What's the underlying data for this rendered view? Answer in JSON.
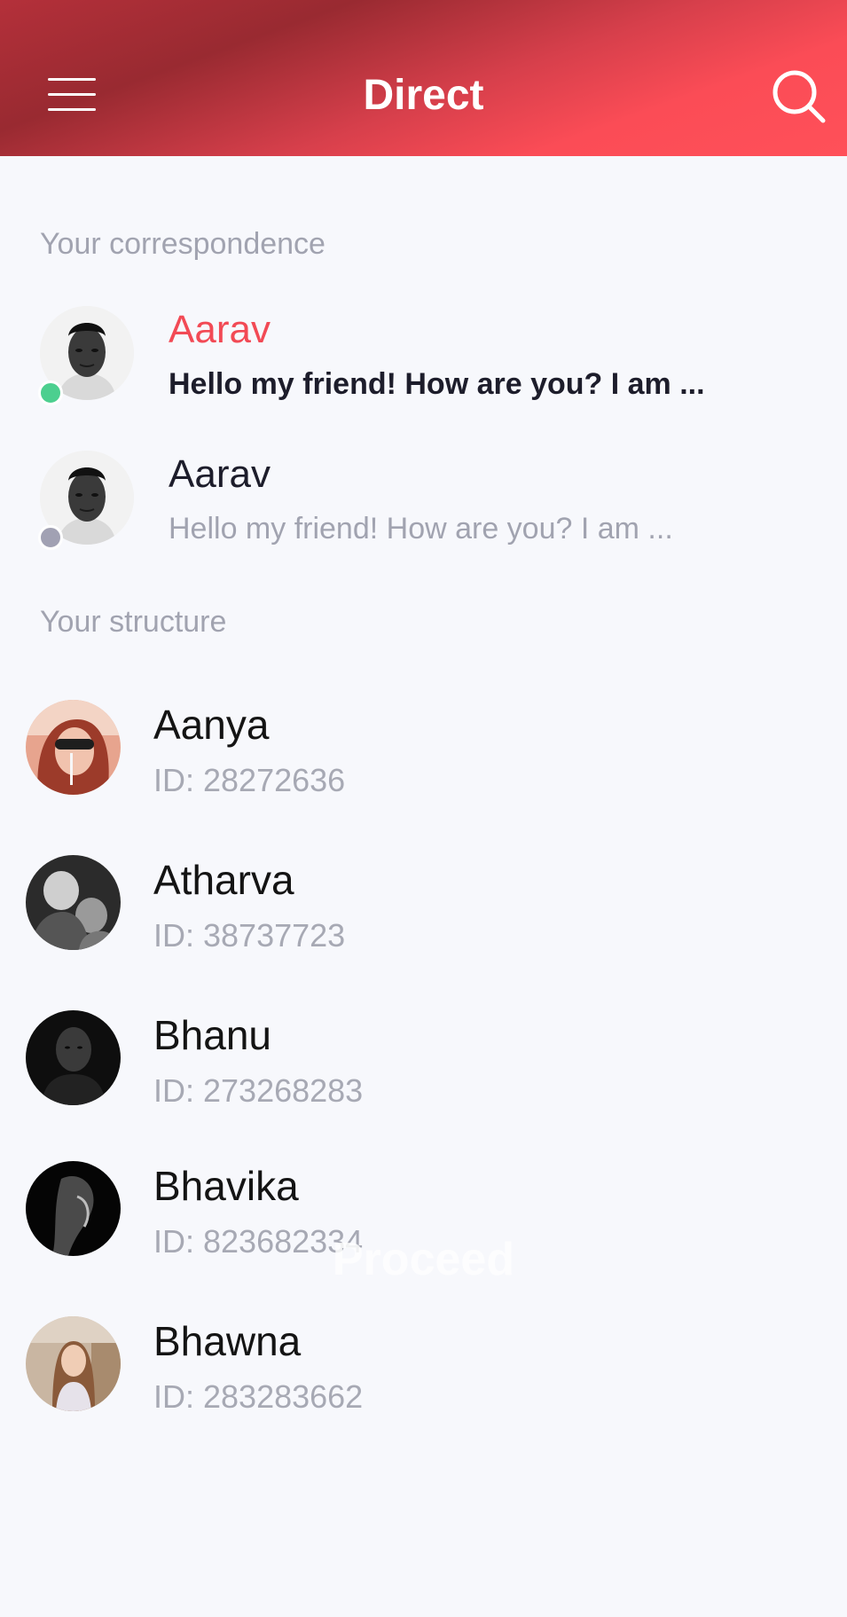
{
  "header": {
    "title": "Direct",
    "menu_icon": "hamburger-menu-icon",
    "search_icon": "search-icon"
  },
  "correspondence": {
    "label": "Your correspondence",
    "items": [
      {
        "name": "Aarav",
        "message": "Hello my friend! How are you? I am ...",
        "online": true,
        "unread": true
      },
      {
        "name": "Aarav",
        "message": "Hello my friend! How are you? I am ...",
        "online": false,
        "unread": false
      }
    ]
  },
  "structure": {
    "label": "Your structure",
    "members": [
      {
        "name": "Aanya",
        "id": "ID: 28272636"
      },
      {
        "name": "Atharva",
        "id": "ID: 38737723"
      },
      {
        "name": "Bhanu",
        "id": "ID: 273268283"
      },
      {
        "name": "Bhavika",
        "id": "ID: 823682334"
      },
      {
        "name": "Bhawna",
        "id": "ID: 283283662"
      }
    ]
  },
  "proceed_label": "Proceed",
  "colors": {
    "accent": "#f24a55",
    "online": "#4ccf8f",
    "offline": "#a1a1b3",
    "muted_text": "#a1a3b0",
    "dark_text": "#1d1d2b"
  }
}
